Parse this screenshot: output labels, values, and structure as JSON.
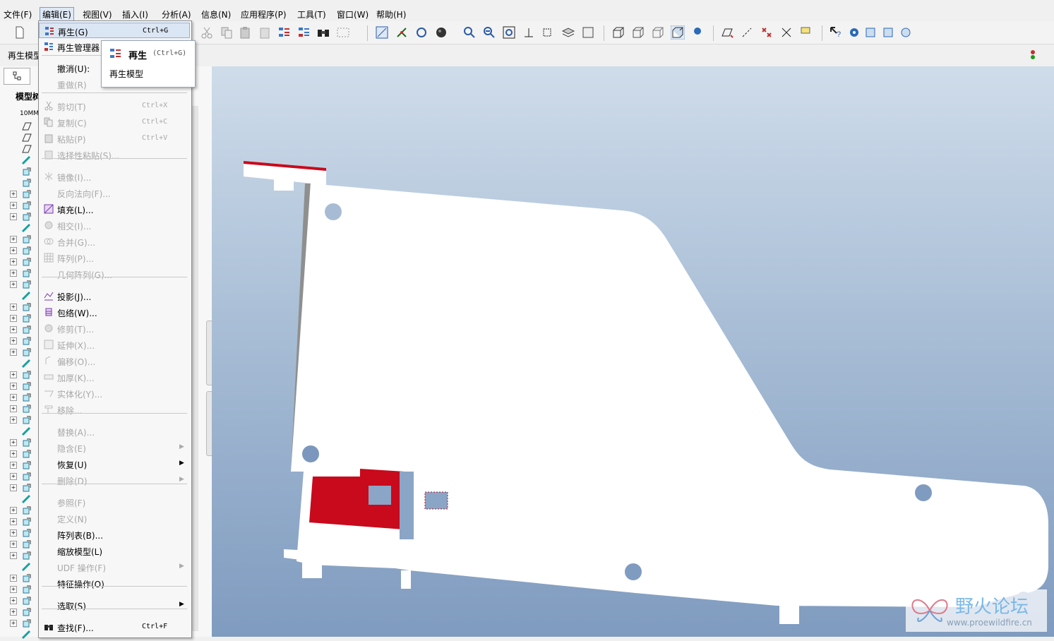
{
  "menubar": {
    "items": [
      "文件(F)",
      "编辑(E)",
      "视图(V)",
      "插入(I)",
      "分析(A)",
      "信息(N)",
      "应用程序(P)",
      "工具(T)",
      "窗口(W)",
      "帮助(H)"
    ]
  },
  "message_row": {
    "text": "再生模型"
  },
  "left_panel": {
    "header": "模型树",
    "root_label": "10MM"
  },
  "edit_menu": {
    "items": [
      {
        "label": "再生(G)",
        "shortcut": "Ctrl+G",
        "disabled": false,
        "icon": "regenerate-icon"
      },
      {
        "label": "再生管理器",
        "shortcut": "",
        "disabled": false,
        "icon": "regen-manager-icon"
      },
      {
        "label": "撤消(U):",
        "shortcut": "",
        "disabled": false,
        "icon": ""
      },
      {
        "label": "重做(R)",
        "shortcut": "",
        "disabled": true,
        "icon": ""
      },
      {
        "label": "剪切(T)",
        "shortcut": "Ctrl+X",
        "disabled": true,
        "icon": "scissors-icon"
      },
      {
        "label": "复制(C)",
        "shortcut": "Ctrl+C",
        "disabled": true,
        "icon": "copy-icon"
      },
      {
        "label": "粘贴(P)",
        "shortcut": "Ctrl+V",
        "disabled": true,
        "icon": "paste-icon"
      },
      {
        "label": "选择性粘贴(S)...",
        "shortcut": "",
        "disabled": true,
        "icon": "paste-special-icon"
      },
      {
        "label": "镜像(I)...",
        "shortcut": "",
        "disabled": true,
        "icon": "mirror-icon"
      },
      {
        "label": "反向法向(F)...",
        "shortcut": "",
        "disabled": true,
        "icon": ""
      },
      {
        "label": "填充(L)...",
        "shortcut": "",
        "disabled": false,
        "icon": "fill-icon"
      },
      {
        "label": "相交(I)...",
        "shortcut": "",
        "disabled": true,
        "icon": "intersect-icon"
      },
      {
        "label": "合并(G)...",
        "shortcut": "",
        "disabled": true,
        "icon": "merge-icon"
      },
      {
        "label": "阵列(P)...",
        "shortcut": "",
        "disabled": true,
        "icon": "pattern-icon"
      },
      {
        "label": "几何阵列(G)...",
        "shortcut": "",
        "disabled": true,
        "icon": ""
      },
      {
        "label": "投影(J)...",
        "shortcut": "",
        "disabled": false,
        "icon": "project-icon"
      },
      {
        "label": "包络(W)...",
        "shortcut": "",
        "disabled": false,
        "icon": "wrap-icon"
      },
      {
        "label": "修剪(T)...",
        "shortcut": "",
        "disabled": true,
        "icon": "trim-icon"
      },
      {
        "label": "延伸(X)...",
        "shortcut": "",
        "disabled": true,
        "icon": "extend-icon"
      },
      {
        "label": "偏移(O)...",
        "shortcut": "",
        "disabled": true,
        "icon": "offset-icon"
      },
      {
        "label": "加厚(K)...",
        "shortcut": "",
        "disabled": true,
        "icon": "thicken-icon"
      },
      {
        "label": "实体化(Y)...",
        "shortcut": "",
        "disabled": true,
        "icon": "solidify-icon"
      },
      {
        "label": "移除...",
        "shortcut": "",
        "disabled": true,
        "icon": "remove-icon"
      },
      {
        "label": "替换(A)...",
        "shortcut": "",
        "disabled": true,
        "icon": ""
      },
      {
        "label": "隐含(E)",
        "shortcut": "",
        "disabled": true,
        "icon": "",
        "submenu": true
      },
      {
        "label": "恢复(U)",
        "shortcut": "",
        "disabled": false,
        "icon": "",
        "submenu": true
      },
      {
        "label": "删除(D)",
        "shortcut": "",
        "disabled": true,
        "icon": "",
        "submenu": true
      },
      {
        "label": "参照(F)",
        "shortcut": "",
        "disabled": true,
        "icon": ""
      },
      {
        "label": "定义(N)",
        "shortcut": "",
        "disabled": true,
        "icon": ""
      },
      {
        "label": "阵列表(B)...",
        "shortcut": "",
        "disabled": false,
        "icon": ""
      },
      {
        "label": "缩放模型(L)",
        "shortcut": "",
        "disabled": false,
        "icon": ""
      },
      {
        "label": "UDF 操作(F)",
        "shortcut": "",
        "disabled": true,
        "icon": "",
        "submenu": true
      },
      {
        "label": "特征操作(O)",
        "shortcut": "",
        "disabled": false,
        "icon": ""
      },
      {
        "label": "选取(S)",
        "shortcut": "",
        "disabled": false,
        "icon": "",
        "submenu": true
      },
      {
        "label": "查找(F)...",
        "shortcut": "Ctrl+F",
        "disabled": false,
        "icon": "binoculars-icon"
      }
    ]
  },
  "tooltip": {
    "title": "再生",
    "shortcut": "(Ctrl+G)",
    "description": "再生模型"
  },
  "watermark": {
    "text": "野火论坛",
    "url": "www.proewildfire.cn"
  },
  "colors": {
    "highlight_red": "#c80a1c",
    "part_white": "#ffffff",
    "viewport_top": "#cfdcea",
    "viewport_bottom": "#7f9bbf"
  }
}
